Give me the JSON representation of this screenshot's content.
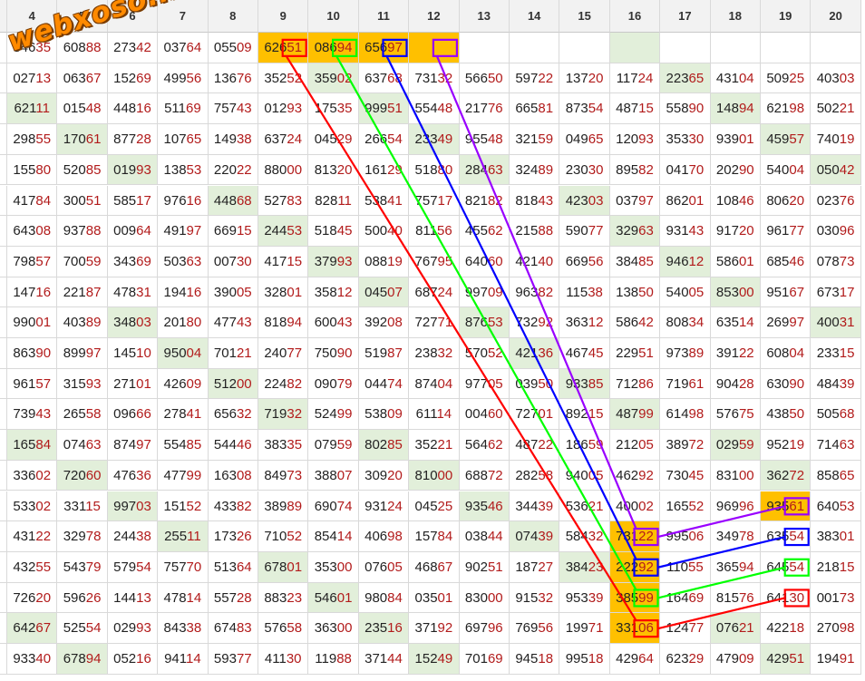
{
  "watermark": "webxoso.net",
  "colors": {
    "highlight_green": "#e2efda",
    "highlight_orange": "#ffc000",
    "red_digits": "#b21b1b",
    "line_red": "#ff0000",
    "line_green": "#00ff00",
    "line_blue": "#0000ff",
    "line_purple": "#9900ff"
  },
  "table": {
    "columns": [
      "4",
      "5",
      "6",
      "7",
      "8",
      "9",
      "10",
      "11",
      "12",
      "13",
      "14",
      "15",
      "16",
      "17",
      "18",
      "19",
      "20"
    ],
    "rows": [
      [
        "84635",
        "60888",
        "27342",
        "03764",
        "05509",
        "62651",
        "08694",
        "65697",
        "",
        "",
        "",
        "",
        "",
        "",
        "",
        "",
        ""
      ],
      [
        "02713",
        "06367",
        "15269",
        "49956",
        "13676",
        "35252",
        "35902",
        "63768",
        "73132",
        "56650",
        "59722",
        "13720",
        "11724",
        "22365",
        "43104",
        "50925",
        "40303"
      ],
      [
        "62111",
        "01548",
        "44816",
        "51169",
        "75743",
        "01293",
        "17535",
        "99951",
        "55448",
        "21776",
        "66581",
        "87354",
        "48715",
        "55890",
        "14894",
        "62198",
        "50221"
      ],
      [
        "29855",
        "17061",
        "87728",
        "10765",
        "14938",
        "63724",
        "04529",
        "26654",
        "23349",
        "95548",
        "32159",
        "04965",
        "12093",
        "35330",
        "93901",
        "45957",
        "74019"
      ],
      [
        "15580",
        "52085",
        "01993",
        "13853",
        "22022",
        "88000",
        "81320",
        "16129",
        "51880",
        "28463",
        "32489",
        "23030",
        "89582",
        "04170",
        "20290",
        "54004",
        "05042"
      ],
      [
        "41784",
        "30051",
        "58517",
        "97616",
        "44868",
        "52783",
        "82811",
        "53841",
        "75717",
        "82182",
        "81843",
        "42303",
        "03797",
        "86201",
        "10846",
        "80620",
        "02376"
      ],
      [
        "64308",
        "93788",
        "00964",
        "49197",
        "66915",
        "24453",
        "51845",
        "50040",
        "81156",
        "45562",
        "21588",
        "59077",
        "32963",
        "93143",
        "91720",
        "96177",
        "03096"
      ],
      [
        "79857",
        "70059",
        "34369",
        "50363",
        "00730",
        "41715",
        "37993",
        "08819",
        "76795",
        "64060",
        "42140",
        "66956",
        "38485",
        "94612",
        "58601",
        "68546",
        "07873"
      ],
      [
        "14716",
        "22187",
        "47831",
        "19416",
        "39005",
        "32801",
        "35812",
        "04507",
        "68724",
        "99709",
        "96382",
        "11538",
        "13850",
        "54005",
        "85300",
        "95167",
        "67317"
      ],
      [
        "99001",
        "40389",
        "34803",
        "20180",
        "47743",
        "81894",
        "60043",
        "39208",
        "72771",
        "87653",
        "73292",
        "36312",
        "58642",
        "80834",
        "63514",
        "26997",
        "40031"
      ],
      [
        "86390",
        "89997",
        "14510",
        "95004",
        "70121",
        "24077",
        "75090",
        "51987",
        "23832",
        "57052",
        "42136",
        "46745",
        "22951",
        "97389",
        "39122",
        "60804",
        "23315"
      ],
      [
        "96157",
        "31593",
        "27101",
        "42609",
        "51200",
        "22482",
        "09079",
        "04474",
        "87404",
        "97705",
        "03950",
        "93385",
        "71286",
        "71961",
        "90428",
        "63090",
        "48439"
      ],
      [
        "73943",
        "26558",
        "09666",
        "27841",
        "65632",
        "71932",
        "52499",
        "53809",
        "61114",
        "00460",
        "72701",
        "89215",
        "48799",
        "61498",
        "57675",
        "43850",
        "50568"
      ],
      [
        "16584",
        "07463",
        "87497",
        "55485",
        "54446",
        "38335",
        "07959",
        "80285",
        "35221",
        "56462",
        "48722",
        "18659",
        "21205",
        "38972",
        "02959",
        "95219",
        "71463"
      ],
      [
        "33602",
        "72060",
        "47636",
        "47799",
        "16308",
        "84973",
        "38807",
        "30920",
        "81000",
        "68872",
        "28258",
        "94005",
        "46292",
        "73045",
        "83100",
        "36272",
        "85865"
      ],
      [
        "53302",
        "33115",
        "99703",
        "15152",
        "43382",
        "38989",
        "69074",
        "93124",
        "04525",
        "93546",
        "34439",
        "53621",
        "40002",
        "16552",
        "96996",
        "93561",
        "64053"
      ],
      [
        "43122",
        "32978",
        "24438",
        "25511",
        "17326",
        "71052",
        "85414",
        "40698",
        "15784",
        "03844",
        "07439",
        "58432",
        "73122",
        "99506",
        "34978",
        "63554",
        "38301"
      ],
      [
        "43255",
        "54379",
        "57954",
        "75770",
        "51364",
        "67801",
        "35300",
        "07605",
        "46867",
        "90251",
        "18727",
        "38423",
        "22292",
        "11055",
        "36594",
        "64554",
        "21815"
      ],
      [
        "72620",
        "59626",
        "14413",
        "47814",
        "55728",
        "88323",
        "54601",
        "98084",
        "03501",
        "83000",
        "91532",
        "95339",
        "38599",
        "16469",
        "81576",
        "64130",
        "00173"
      ],
      [
        "64267",
        "52554",
        "02993",
        "84338",
        "67483",
        "57658",
        "36300",
        "23516",
        "37192",
        "69796",
        "76956",
        "19971",
        "33106",
        "12477",
        "07621",
        "42218",
        "27098"
      ],
      [
        "93340",
        "67894",
        "05216",
        "94114",
        "59377",
        "41130",
        "11988",
        "37144",
        "15249",
        "70169",
        "94518",
        "99518",
        "42964",
        "62329",
        "47909",
        "42951",
        "19491"
      ]
    ]
  }
}
